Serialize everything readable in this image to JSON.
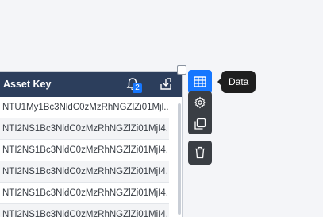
{
  "table": {
    "header": "Asset Key",
    "notification_count": "2",
    "rows": [
      "NTU1My1Bc3NldC0zMzRhNGZlZi01Mjl...",
      "NTI2NS1Bc3NldC0zMzRhNGZlZi01MjI4...",
      "NTI2NS1Bc3NldC0zMzRhNGZlZi01MjI4...",
      "NTI2NS1Bc3NldC0zMzRhNGZlZi01MjI4...",
      "NTI2NS1Bc3NldC0zMzRhNGZlZi01MjI4...",
      "NTI2NS1Bc3NldC0zMzRhNGZlZi01MjI4..."
    ]
  },
  "toolbar": {
    "tooltip": "Data",
    "icons": [
      "table-icon",
      "gear-icon",
      "copy-icon",
      "trash-icon"
    ],
    "accent_color": "#1677ff"
  },
  "colors": {
    "header_bg": "#2c3e5c",
    "tool_bg": "#3a3e44",
    "tooltip_bg": "#1f1f1f"
  }
}
